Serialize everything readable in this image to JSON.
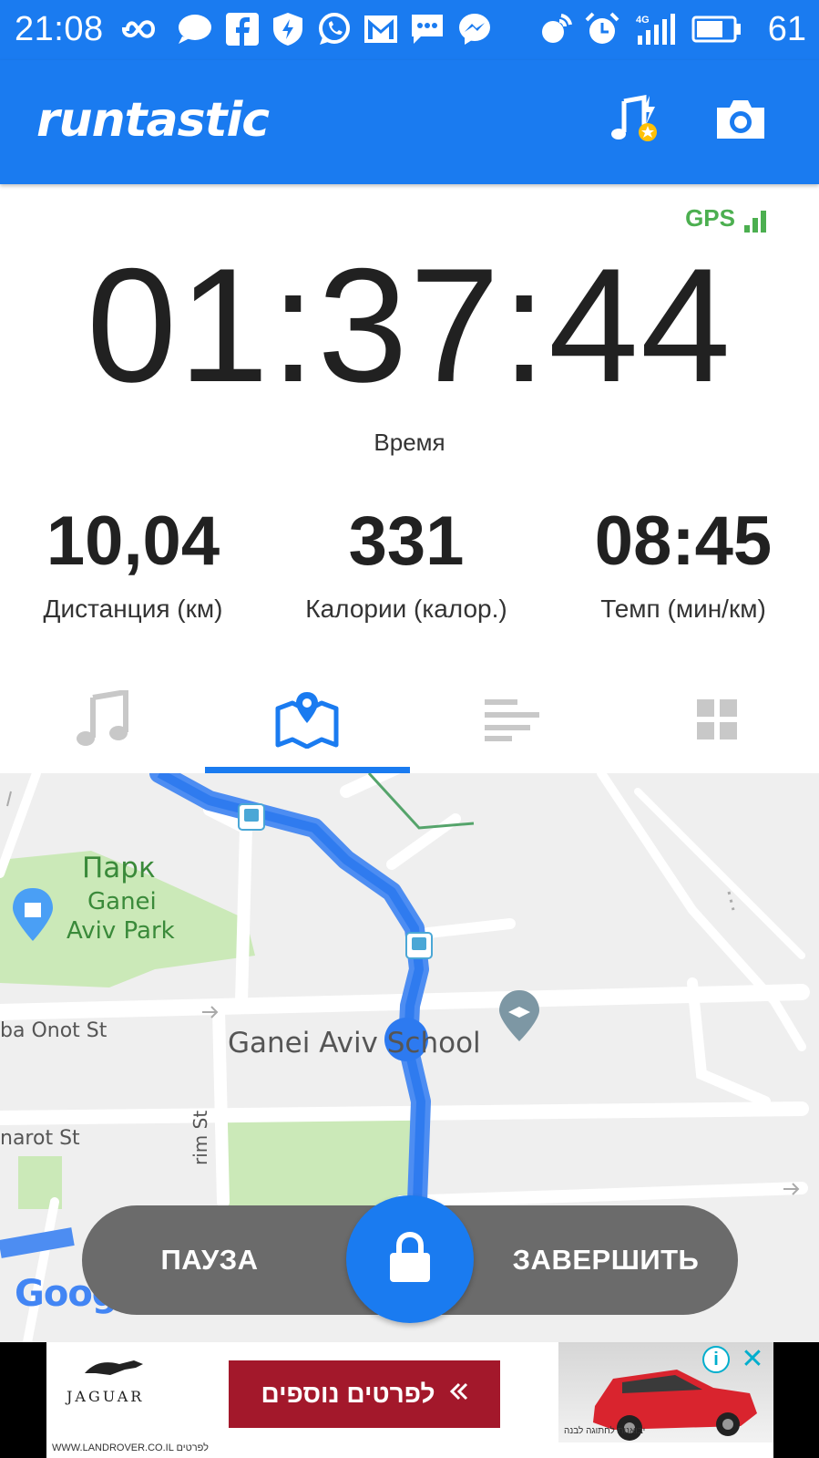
{
  "status_bar": {
    "time": "21:08",
    "battery": "61",
    "network": "4G",
    "icons": [
      "infinity-icon",
      "chat-bubble-icon",
      "facebook-icon",
      "shield-icon",
      "whatsapp-icon",
      "gmail-icon",
      "sms-icon",
      "messenger-icon",
      "data-sync-icon",
      "alarm-icon",
      "signal-icon",
      "battery-icon"
    ]
  },
  "app_bar": {
    "logo": "runtastic",
    "actions": [
      "music-powersong-icon",
      "camera-icon"
    ]
  },
  "colors": {
    "primary": "#1a7bf0",
    "gps_green": "#4caf50",
    "controls_gray": "#6b6b6b",
    "ad_red": "#a3182b"
  },
  "stats": {
    "gps": "GPS",
    "timer": "01:37:44",
    "timer_label": "Время",
    "distance": {
      "value": "10,04",
      "label": "Дистанция (км)"
    },
    "calories": {
      "value": "331",
      "label": "Калории (калор.)"
    },
    "pace": {
      "value": "08:45",
      "label": "Темп (мин/км)"
    }
  },
  "tabs": [
    {
      "icon": "music-note-icon",
      "active": false
    },
    {
      "icon": "map-pin-icon",
      "active": true
    },
    {
      "icon": "list-bars-icon",
      "active": false
    },
    {
      "icon": "grid-icon",
      "active": false
    }
  ],
  "map": {
    "park_label_ru": "Парк",
    "park_label_1": "Ganei",
    "park_label_2": "Aviv Park",
    "street_1": "ba Onot St",
    "street_2": "Ganei Aviv School",
    "street_3": "narot St",
    "street_4": "rim St",
    "attribution": "Google"
  },
  "controls": {
    "pause": "ПАУЗА",
    "finish": "ЗАВЕРШИТЬ"
  },
  "ad": {
    "brand": "JAGUAR",
    "cta": "לפרטים נוספים",
    "url": "WWW.LANDROVER.CO.IL לפרטים",
    "fine_print": "יבואנות לחתוגה לבנה"
  }
}
